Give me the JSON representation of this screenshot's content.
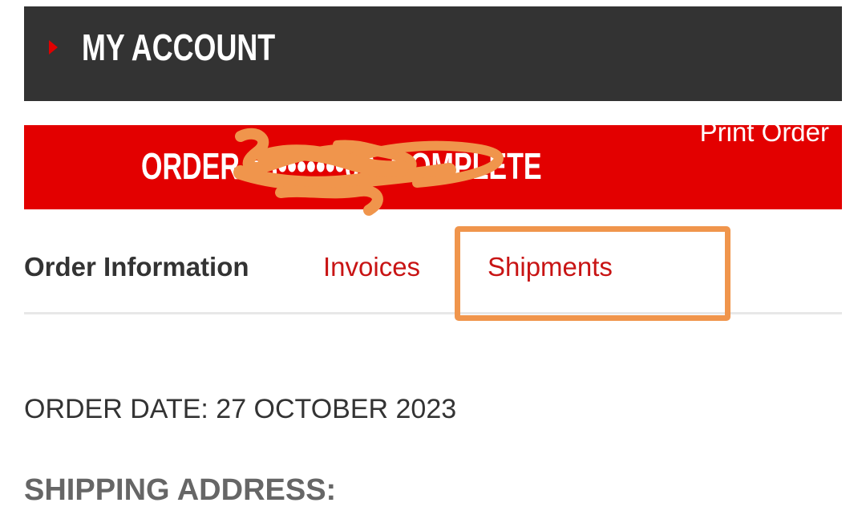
{
  "header": {
    "title": "MY ACCOUNT"
  },
  "order": {
    "title": "ORDER #3•••••••09  COMPLETE",
    "print_label": "Print Order"
  },
  "tabs": [
    {
      "label": "Order Information"
    },
    {
      "label": "Invoices"
    },
    {
      "label": "Shipments"
    }
  ],
  "details": {
    "order_date": "ORDER DATE: 27 OCTOBER 2023",
    "shipping_label": "SHIPPING ADDRESS:"
  },
  "colors": {
    "header_bg": "#333333",
    "order_bar_bg": "#e30000",
    "link_red": "#c81414",
    "annotation_orange": "#f0954c"
  },
  "icons": {
    "header_arrow": "caret-right-icon"
  }
}
